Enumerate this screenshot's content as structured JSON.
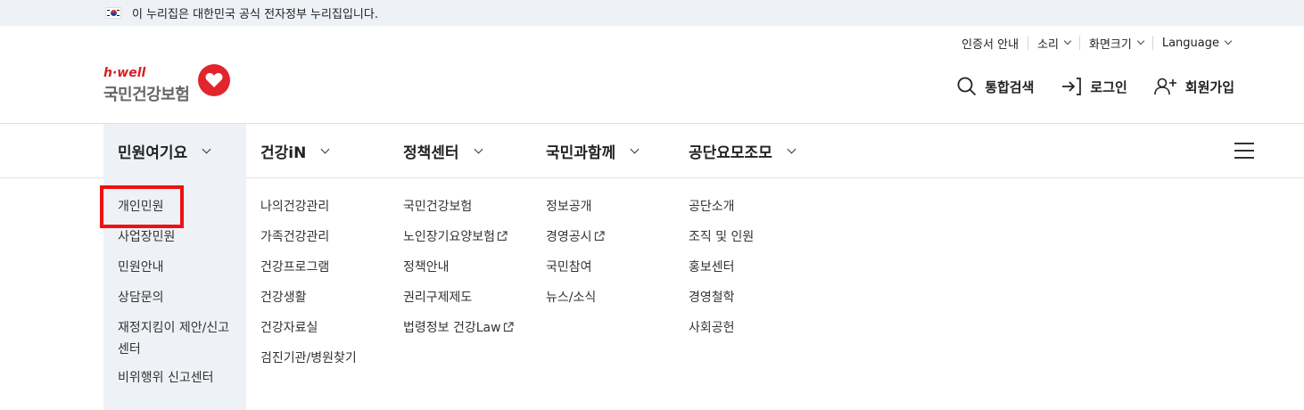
{
  "gov_banner": {
    "text": "이 누리집은 대한민국 공식 전자정부 누리집입니다."
  },
  "utility": {
    "certificate": "인증서 안내",
    "sound": "소리",
    "font_size": "화면크기",
    "language": "Language"
  },
  "logo": {
    "sub": "h·well",
    "main": "국민건강보험"
  },
  "actions": {
    "search": "통합검색",
    "login": "로그인",
    "signup": "회원가입"
  },
  "gnb": [
    {
      "label": "민원여기요",
      "active": true
    },
    {
      "label": "건강iN"
    },
    {
      "label": "정책센터"
    },
    {
      "label": "국민과함께"
    },
    {
      "label": "공단요모조모"
    }
  ],
  "submenus": [
    [
      "개인민원",
      "사업장민원",
      "민원안내",
      "상담문의",
      "재정지킴이 제안/신고센터",
      "비위행위 신고센터"
    ],
    [
      "나의건강관리",
      "가족건강관리",
      "건강프로그램",
      "건강생활",
      "건강자료실",
      "검진기관/병원찾기"
    ],
    [
      "국민건강보험",
      "노인장기요양보험",
      "정책안내",
      "권리구제제도",
      "법령정보 건강Law"
    ],
    [
      "정보공개",
      "경영공시",
      "국민참여",
      "뉴스/소식"
    ],
    [
      "공단소개",
      "조직 및 인원",
      "홍보센터",
      "경영철학",
      "사회공헌"
    ]
  ],
  "colors": {
    "brand_red": "#e2242d",
    "active_bg": "#eef1f6",
    "highlight": "#ee1111"
  }
}
